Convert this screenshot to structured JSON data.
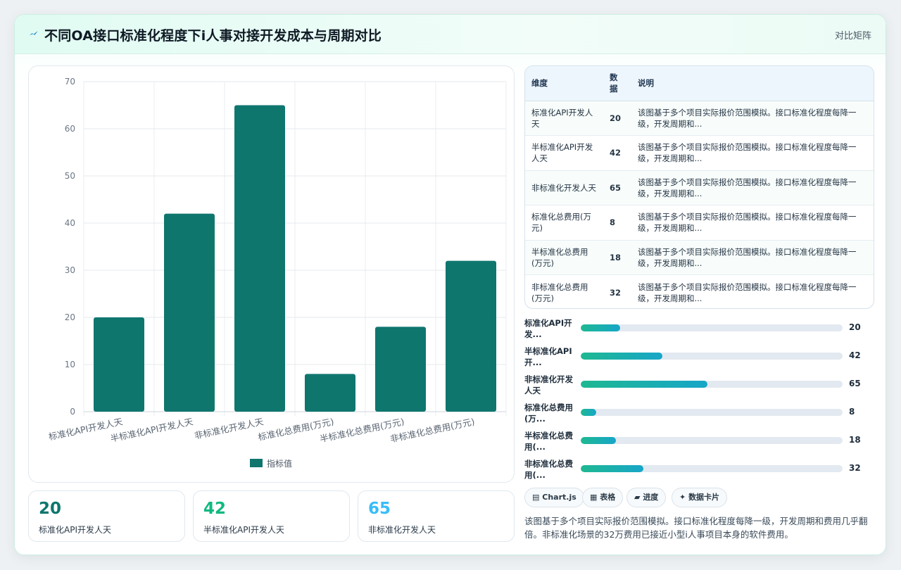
{
  "header": {
    "title": "不同OA接口标准化程度下i人事对接开发成本与周期对比",
    "tag": "对比矩阵"
  },
  "chart_data": {
    "type": "bar",
    "categories": [
      "标准化API开发人天",
      "半标准化API开发人天",
      "非标准化开发人天",
      "标准化总费用(万元)",
      "半标准化总费用(万元)",
      "非标准化总费用(万元)"
    ],
    "series": [
      {
        "name": "指标值",
        "values": [
          20,
          42,
          65,
          8,
          18,
          32
        ]
      }
    ],
    "ylim": [
      0,
      70
    ],
    "yticks": [
      0,
      10,
      20,
      30,
      40,
      50,
      60,
      70
    ],
    "grid": true,
    "legend": "bottom",
    "bar_color": "#0f766e"
  },
  "kpis": [
    {
      "value": "20",
      "label": "标准化API开发人天",
      "color": "#0f766e"
    },
    {
      "value": "42",
      "label": "半标准化API开发人天",
      "color": "#10b981"
    },
    {
      "value": "65",
      "label": "非标准化开发人天",
      "color": "#38bdf8"
    }
  ],
  "table": {
    "headers": [
      "维度",
      "数据",
      "说明"
    ],
    "rows": [
      {
        "dim": "标准化API开发人天",
        "val": "20",
        "desc": "该图基于多个项目实际报价范围模拟。接口标准化程度每降一级，开发周期和..."
      },
      {
        "dim": "半标准化API开发人天",
        "val": "42",
        "desc": "该图基于多个项目实际报价范围模拟。接口标准化程度每降一级，开发周期和..."
      },
      {
        "dim": "非标准化开发人天",
        "val": "65",
        "desc": "该图基于多个项目实际报价范围模拟。接口标准化程度每降一级，开发周期和..."
      },
      {
        "dim": "标准化总费用(万元)",
        "val": "8",
        "desc": "该图基于多个项目实际报价范围模拟。接口标准化程度每降一级，开发周期和..."
      },
      {
        "dim": "半标准化总费用(万元)",
        "val": "18",
        "desc": "该图基于多个项目实际报价范围模拟。接口标准化程度每降一级，开发周期和..."
      },
      {
        "dim": "非标准化总费用(万元)",
        "val": "32",
        "desc": "该图基于多个项目实际报价范围模拟。接口标准化程度每降一级，开发周期和..."
      }
    ]
  },
  "progress": [
    {
      "label": "标准化API开发...",
      "value": "20",
      "ratio": 0.1497
    },
    {
      "label": "半标准化API开...",
      "value": "42",
      "ratio": 0.3128
    },
    {
      "label": "非标准化开发人天",
      "value": "65",
      "ratio": 0.484
    },
    {
      "label": "标准化总费用(万...",
      "value": "8",
      "ratio": 0.0588
    },
    {
      "label": "半标准化总费用(...",
      "value": "18",
      "ratio": 0.1337
    },
    {
      "label": "非标准化总费用(...",
      "value": "32",
      "ratio": 0.238
    }
  ],
  "chips": [
    {
      "icon": "▤",
      "label": "Chart.js"
    },
    {
      "icon": "▦",
      "label": "表格"
    },
    {
      "icon": "▰",
      "label": "进度"
    },
    {
      "icon": "✦",
      "label": "数据卡片"
    }
  ],
  "note": "该图基于多个项目实际报价范围模拟。接口标准化程度每降一级，开发周期和费用几乎翻倍。非标准化场景的32万费用已接近小型i人事项目本身的软件费用。",
  "colors": {
    "accent": "#0f766e",
    "teal": "#10b981",
    "sky": "#38bdf8"
  }
}
